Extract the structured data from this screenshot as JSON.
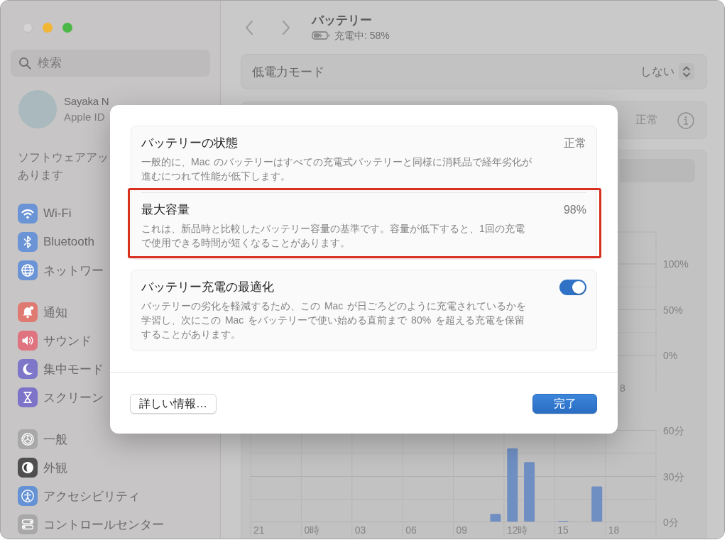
{
  "window": {
    "controls": [
      {
        "kind": "close",
        "disabled": true
      },
      {
        "kind": "minimize",
        "disabled": false
      },
      {
        "kind": "zoom",
        "disabled": false
      }
    ]
  },
  "sidebar": {
    "search": {
      "placeholder": "検索"
    },
    "account": {
      "name": "Sayaka N",
      "subtitle": "Apple ID"
    },
    "notice_lines": [
      "ソフトウェアアッ",
      "あります"
    ],
    "groups": [
      {
        "items": [
          {
            "label": "Wi-Fi",
            "color": "#6b94d6",
            "selected": false
          },
          {
            "label": "Bluetooth",
            "color": "#6b94d6",
            "selected": false
          },
          {
            "label": "ネットワー",
            "color": "#6b94d6",
            "selected": false
          }
        ]
      },
      {
        "items": [
          {
            "label": "通知",
            "color": "#df7a72",
            "selected": false
          },
          {
            "label": "サウンド",
            "color": "#df737f",
            "selected": false
          },
          {
            "label": "集中モード",
            "color": "#7d76c9",
            "selected": false
          },
          {
            "label": "スクリーン",
            "color": "#7d73c9",
            "selected": false
          }
        ]
      },
      {
        "items": [
          {
            "label": "一般",
            "color": "#a8a8a8",
            "selected": false
          },
          {
            "label": "外観",
            "color": "#4f4f4f",
            "selected": false
          },
          {
            "label": "アクセシビリティ",
            "color": "#6592d5",
            "selected": false
          },
          {
            "label": "コントロールセンター",
            "color": "#a8a8a8",
            "selected": false
          }
        ]
      }
    ]
  },
  "header": {
    "title": "バッテリー",
    "status": "充電中: 58%"
  },
  "low_power_mode": {
    "label": "低電力モード",
    "value": "しない"
  },
  "status_row": {
    "value": "正常"
  },
  "percent_chart": {
    "axis_labels": [
      "100%",
      "50%",
      "0%"
    ],
    "x_label": "8"
  },
  "usage_chart": {
    "chart_data": {
      "type": "bar",
      "categories": [
        "21",
        null,
        null,
        "0時",
        null,
        null,
        "03",
        null,
        null,
        "06",
        null,
        null,
        "09",
        null,
        null,
        "12時",
        null,
        null,
        "15",
        null,
        null,
        "18",
        null,
        null
      ],
      "values": [
        0,
        0,
        0,
        0,
        0,
        0,
        0,
        0,
        0,
        0,
        0,
        0,
        0,
        0,
        5,
        48,
        39,
        0,
        0.5,
        0,
        23,
        0,
        0,
        0
      ],
      "ylim": [
        0,
        60
      ],
      "yticks": [
        {
          "value": 0,
          "label": "0分"
        },
        {
          "value": 30,
          "label": "30分"
        },
        {
          "value": 60,
          "label": "60分"
        }
      ]
    }
  },
  "dialog": {
    "groups": [
      {
        "rows": [
          {
            "kind": "value",
            "title": "バッテリーの状態",
            "value": "正常",
            "description": "一般的に、Mac のバッテリーはすべての充電式バッテリーと同様に消耗品で経年劣化が進むにつれて性能が低下します。",
            "highlighted": false
          },
          {
            "kind": "value",
            "title": "最大容量",
            "value": "98%",
            "description": "これは、新品時と比較したバッテリー容量の基準です。容量が低下すると、1回の充電で使用できる時間が短くなることがあります。",
            "highlighted": true
          }
        ]
      },
      {
        "rows": [
          {
            "kind": "toggle",
            "title": "バッテリー充電の最適化",
            "on": true,
            "description": "バッテリーの劣化を軽減するため、この Mac が日ごろどのように充電されているかを学習し、次にこの Mac をバッテリーで使い始める直前まで 80% を超える充電を保留することがあります。",
            "highlighted": false
          }
        ]
      }
    ],
    "buttons": [
      {
        "label": "詳しい情報…",
        "default": false
      },
      {
        "label": "完了",
        "default": true
      }
    ]
  }
}
